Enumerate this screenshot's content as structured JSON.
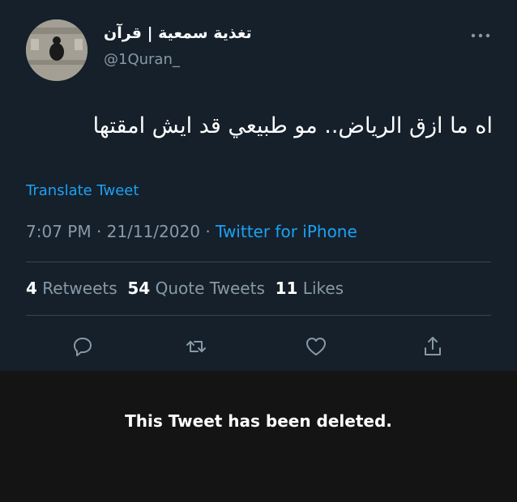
{
  "tweet": {
    "author": {
      "display_name": "تغذية سمعية | قرآن",
      "handle": "@1Quran_"
    },
    "more_icon": "more-dots-icon",
    "text": "اه ما ازق الرياض.. مو طبيعي قد ايش امقتها",
    "translate_label": "Translate Tweet",
    "time": "7:07 PM",
    "date": "21/11/2020",
    "separator": "·",
    "source": "Twitter for iPhone",
    "stats": {
      "retweets_count": "4",
      "retweets_label": "Retweets",
      "quote_tweets_count": "54",
      "quote_tweets_label": "Quote Tweets",
      "likes_count": "11",
      "likes_label": "Likes"
    },
    "actions": [
      "reply-icon",
      "retweet-icon",
      "like-icon",
      "share-icon"
    ]
  },
  "notice": {
    "deleted_text": "This Tweet has been deleted."
  },
  "colors": {
    "background": "#15202b",
    "accent": "#1da1f2",
    "secondary_text": "#8899a6",
    "divider": "#38444d",
    "notice_background": "#141414"
  }
}
